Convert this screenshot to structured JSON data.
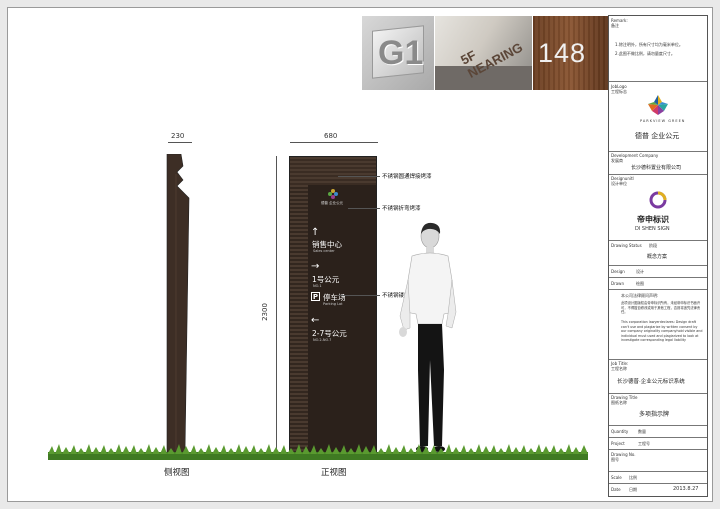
{
  "photos": [
    {
      "text": "G1"
    },
    {
      "text": "5F NEARING"
    },
    {
      "text": "148"
    }
  ],
  "dimensions": {
    "side_width": "230",
    "front_width": "680",
    "height": "2300"
  },
  "sign": {
    "logo_text": "德普 企业公元",
    "items": [
      {
        "arrow": "↑",
        "cn": "销售中心",
        "en": "Sales center"
      },
      {
        "arrow": "→",
        "cn": "1号公元",
        "en": "NO.1"
      },
      {
        "arrow": "P",
        "cn": "停车场",
        "en": "Parking Lot"
      },
      {
        "arrow": "←",
        "cn": "2-7号公元",
        "en": "NO.2-NO.7"
      }
    ]
  },
  "callouts": [
    "不锈钢圆通焊接烤漆",
    "不锈钢折弯烤漆",
    "不锈钢镂切割立体字"
  ],
  "view_labels": {
    "side": "侧视图",
    "front": "正视图"
  },
  "title_block": {
    "remark_label": "Remark:",
    "remark_label_cn": "备注",
    "remark_text_1": "1.除注明外，所有尺寸均为毫米单位。",
    "remark_text_2": "2.此图不做比例，请勿量度尺寸。",
    "job_logo_label": "JobLogo",
    "job_logo_label_cn": "工程标志",
    "client_logo_en": "PARKVIEW GREEN",
    "client_logo_cn": "德普 企业公元",
    "dev_company_label": "Development Company",
    "dev_company_label_cn": "发展商",
    "dev_company": "长沙德科置业有限公司",
    "design_unit_label": "DesignunitI",
    "design_unit_label_cn": "设计单位",
    "designer_logo_cn": "帝申标识",
    "designer_logo_en": "DI SHEN SIGN",
    "drawing_status_label": "Drawing Status",
    "drawing_status_label_cn": "阶段",
    "drawing_status": "概念方案",
    "design_label": "Design",
    "design_value": "设计",
    "drawn_label": "Drawn",
    "drawn_value": "绘图",
    "copyright_title": "本公司法律顾问声明:",
    "copyright_cn": "此项设计图版权由帝申标识所有，未经帝申标识书面许可，不得擅自修改或用于其他工程，否则将追究法律责任。",
    "copyright_en": "This corporation lawyerdeclares: Design draft can't use and plagiarize by written consent by our company originality companyhold visible and individual must used and plagiarized to look at investigate corresponding legal liability",
    "job_title_label": "Job Title:",
    "job_title_label_cn": "工程名称",
    "job_title": "长沙德普·企业公元标识系统",
    "drawing_title_label": "Drawing Title",
    "drawing_title_label_cn": "图纸名称",
    "drawing_title": "多项指示牌",
    "quantity_label": "Quantity",
    "quantity_value": "数量",
    "project_label": "Project",
    "project_value": "工程号",
    "drawing_no_label": "Drawing No.",
    "drawing_no_label_cn": "图号",
    "scale_label": "Scale",
    "scale_value": "比例",
    "date_label": "Date",
    "date_value_cn": "日期",
    "date": "2013.8.27"
  },
  "colors": {
    "sign_brown": "#3d2e25",
    "sign_dark": "#2b211b",
    "grass": "#4f8a2a"
  }
}
